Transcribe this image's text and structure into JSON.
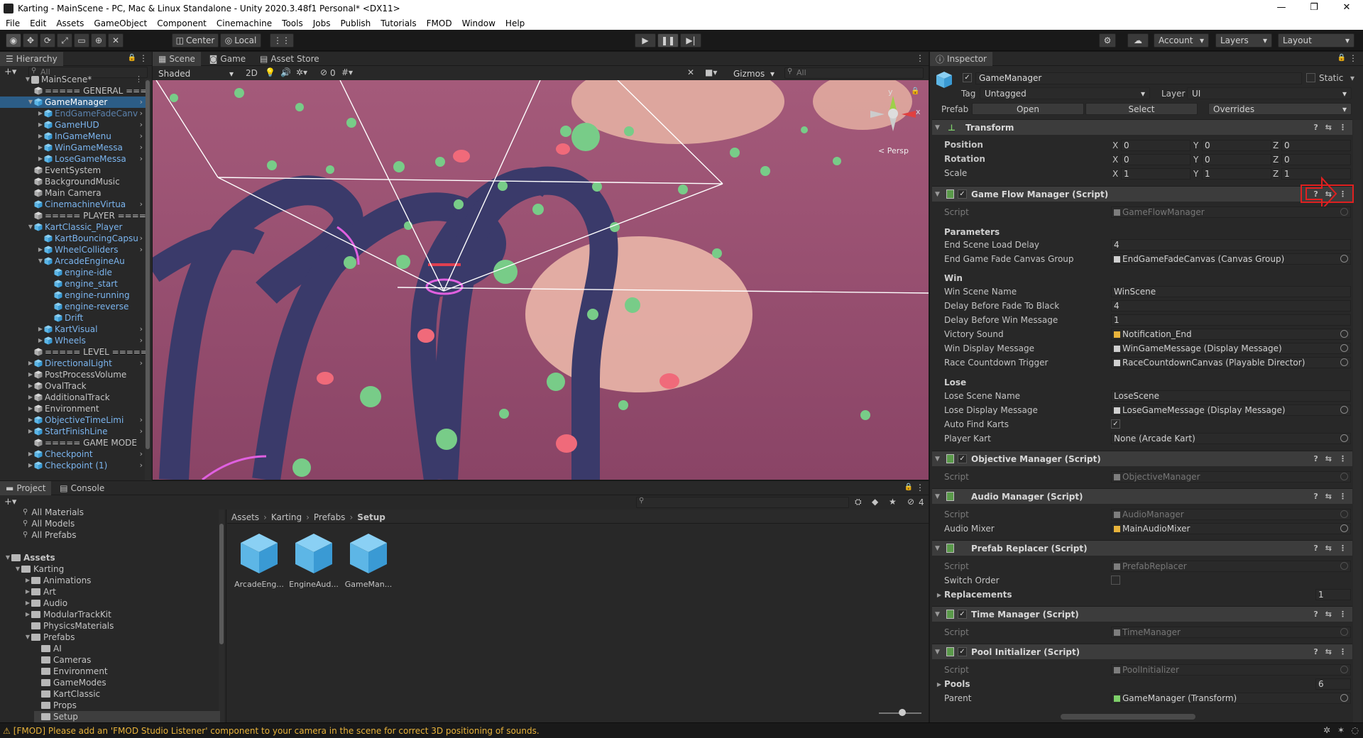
{
  "window": {
    "title": "Karting - MainScene - PC, Mac & Linux Standalone - Unity 2020.3.48f1 Personal* <DX11>",
    "minimize": "—",
    "maximize": "❐",
    "close": "✕"
  },
  "menu": [
    "File",
    "Edit",
    "Assets",
    "GameObject",
    "Component",
    "Cinemachine",
    "Tools",
    "Jobs",
    "Publish",
    "Tutorials",
    "FMOD",
    "Window",
    "Help"
  ],
  "toolbar": {
    "center": "Center",
    "local": "Local",
    "account": "Account",
    "layers": "Layers",
    "layout": "Layout"
  },
  "hierarchy": {
    "tab": "Hierarchy",
    "search_placeholder": "All",
    "scene": "MainScene*",
    "items": [
      {
        "label": "===== GENERAL ===",
        "color": "normal"
      },
      {
        "label": "GameManager",
        "color": "normal"
      },
      {
        "label": "EndGameFadeCanv",
        "color": "faded"
      },
      {
        "label": "GameHUD",
        "color": "blue"
      },
      {
        "label": "InGameMenu",
        "color": "blue"
      },
      {
        "label": "WinGameMessa",
        "color": "blue"
      },
      {
        "label": "LoseGameMessa",
        "color": "blue"
      },
      {
        "label": "EventSystem",
        "color": "normal"
      },
      {
        "label": "BackgroundMusic",
        "color": "normal"
      },
      {
        "label": "Main Camera",
        "color": "normal"
      },
      {
        "label": "CinemachineVirtua",
        "color": "blue"
      },
      {
        "label": "===== PLAYER =====",
        "color": "normal"
      },
      {
        "label": "KartClassic_Player",
        "color": "blue"
      },
      {
        "label": "KartBouncingCapsu",
        "color": "blue"
      },
      {
        "label": "WheelColliders",
        "color": "blue"
      },
      {
        "label": "ArcadeEngineAu",
        "color": "blue"
      },
      {
        "label": "engine-idle",
        "color": "blue"
      },
      {
        "label": "engine_start",
        "color": "blue"
      },
      {
        "label": "engine-running",
        "color": "blue"
      },
      {
        "label": "engine-reverse",
        "color": "blue"
      },
      {
        "label": "Drift",
        "color": "blue"
      },
      {
        "label": "KartVisual",
        "color": "blue"
      },
      {
        "label": "Wheels",
        "color": "blue"
      },
      {
        "label": "===== LEVEL =====",
        "color": "normal"
      },
      {
        "label": "DirectionalLight",
        "color": "blue"
      },
      {
        "label": "PostProcessVolume",
        "color": "normal"
      },
      {
        "label": "OvalTrack",
        "color": "normal"
      },
      {
        "label": "AdditionalTrack",
        "color": "normal"
      },
      {
        "label": "Environment",
        "color": "normal"
      },
      {
        "label": "ObjectiveTimeLimi",
        "color": "blue"
      },
      {
        "label": "StartFinishLine",
        "color": "blue"
      },
      {
        "label": "===== GAME MODE",
        "color": "normal"
      },
      {
        "label": "Checkpoint",
        "color": "blue"
      },
      {
        "label": "Checkpoint (1)",
        "color": "blue"
      }
    ]
  },
  "scene_view": {
    "tabs": [
      "Scene",
      "Game",
      "Asset Store"
    ],
    "shading": "Shaded",
    "mode_2d": "2D",
    "fx_count": "0",
    "gizmos": "Gizmos",
    "search_placeholder": "All",
    "persp": "< Persp",
    "axis_y": "y",
    "axis_x": "x"
  },
  "inspector": {
    "tab": "Inspector",
    "object_name": "GameManager",
    "static_label": "Static",
    "tag_label": "Tag",
    "tag_value": "Untagged",
    "layer_label": "Layer",
    "layer_value": "UI",
    "prefab_label": "Prefab",
    "prefab_open": "Open",
    "prefab_select": "Select",
    "prefab_overrides": "Overrides",
    "transform": {
      "title": "Transform",
      "position_label": "Position",
      "rotation_label": "Rotation",
      "scale_label": "Scale",
      "position": [
        "0",
        "0",
        "0"
      ],
      "rotation": [
        "0",
        "0",
        "0"
      ],
      "scale": [
        "1",
        "1",
        "1"
      ]
    },
    "game_flow": {
      "title": "Game Flow Manager (Script)",
      "script_label": "Script",
      "script_value": "GameFlowManager",
      "parameters": "Parameters",
      "end_scene_delay_label": "End Scene Load Delay",
      "end_scene_delay_value": "4",
      "end_fade_label": "End Game Fade Canvas Group",
      "end_fade_value": "EndGameFadeCanvas (Canvas Group)",
      "win": "Win",
      "win_scene_label": "Win Scene Name",
      "win_scene_value": "WinScene",
      "delay_fade_label": "Delay Before Fade To Black",
      "delay_fade_value": "4",
      "delay_win_label": "Delay Before Win Message",
      "delay_win_value": "1",
      "victory_sound_label": "Victory Sound",
      "victory_sound_value": "Notification_End",
      "win_display_label": "Win Display Message",
      "win_display_value": "WinGameMessage (Display Message)",
      "countdown_label": "Race Countdown Trigger",
      "countdown_value": "RaceCountdownCanvas (Playable Director)",
      "lose": "Lose",
      "lose_scene_label": "Lose Scene Name",
      "lose_scene_value": "LoseScene",
      "lose_display_label": "Lose Display Message",
      "lose_display_value": "LoseGameMessage (Display Message)",
      "auto_find_label": "Auto Find Karts",
      "auto_find_value": "✓",
      "player_kart_label": "Player Kart",
      "player_kart_value": "None (Arcade Kart)"
    },
    "objective": {
      "title": "Objective Manager (Script)",
      "script_label": "Script",
      "script_value": "ObjectiveManager"
    },
    "audio": {
      "title": "Audio Manager (Script)",
      "script_label": "Script",
      "script_value": "AudioManager",
      "mixer_label": "Audio Mixer",
      "mixer_value": "MainAudioMixer"
    },
    "prefab_replacer": {
      "title": "Prefab Replacer (Script)",
      "script_label": "Script",
      "script_value": "PrefabReplacer",
      "switch_label": "Switch Order",
      "replacements_label": "Replacements",
      "replacements_value": "1"
    },
    "time": {
      "title": "Time Manager (Script)",
      "script_label": "Script",
      "script_value": "TimeManager"
    },
    "pool": {
      "title": "Pool Initializer (Script)",
      "script_label": "Script",
      "script_value": "PoolInitializer",
      "pools_label": "Pools",
      "pools_value": "6",
      "parent_label": "Parent",
      "parent_value": "GameManager (Transform)"
    }
  },
  "project": {
    "tabs": [
      "Project",
      "Console"
    ],
    "count": "4",
    "favorites": [
      "All Materials",
      "All Models",
      "All Prefabs"
    ],
    "root": "Assets",
    "tree": [
      {
        "label": "Karting",
        "indent": 1
      },
      {
        "label": "Animations",
        "indent": 2
      },
      {
        "label": "Art",
        "indent": 2
      },
      {
        "label": "Audio",
        "indent": 2
      },
      {
        "label": "ModularTrackKit",
        "indent": 2
      },
      {
        "label": "PhysicsMaterials",
        "indent": 2
      },
      {
        "label": "Prefabs",
        "indent": 2
      },
      {
        "label": "AI",
        "indent": 3
      },
      {
        "label": "Cameras",
        "indent": 3
      },
      {
        "label": "Environment",
        "indent": 3
      },
      {
        "label": "GameModes",
        "indent": 3
      },
      {
        "label": "KartClassic",
        "indent": 3
      },
      {
        "label": "Props",
        "indent": 3
      },
      {
        "label": "Setup",
        "indent": 3
      }
    ],
    "breadcrumb": [
      "Assets",
      "Karting",
      "Prefabs",
      "Setup"
    ],
    "assets": [
      "ArcadeEng...",
      "EngineAud...",
      "GameMan..."
    ]
  },
  "status": {
    "message": "[FMOD] Please add an 'FMOD Studio Listener' component to your camera in the scene for correct 3D positioning of sounds."
  }
}
